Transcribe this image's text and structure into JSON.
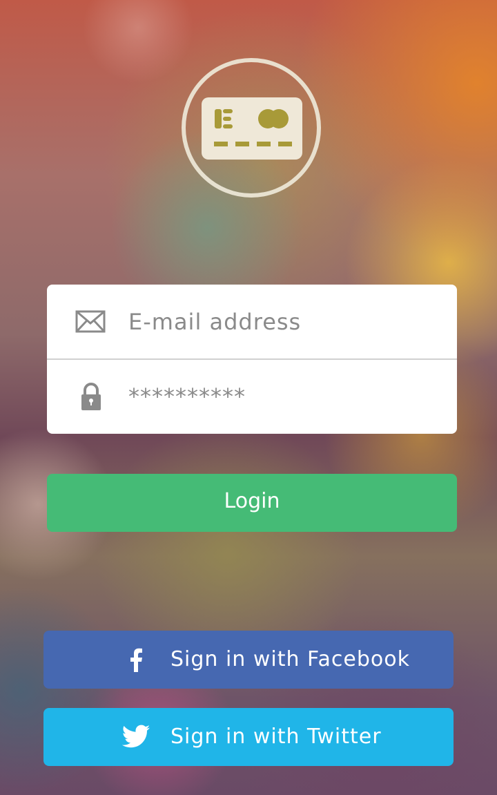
{
  "app": {
    "logo_icon": "credit-card-icon",
    "background_style": "blurred bokeh"
  },
  "login_form": {
    "email": {
      "icon": "envelope-icon",
      "placeholder": "E-mail address"
    },
    "password": {
      "icon": "lock-icon",
      "value": "**********"
    }
  },
  "buttons": {
    "login_label": "Login",
    "facebook_label": "Sign in with Facebook",
    "twitter_label": "Sign in with Twitter"
  },
  "colors": {
    "login": "#45bb76",
    "facebook": "#4668b1",
    "twitter": "#20b5e8",
    "field_text": "#8a8a8a"
  }
}
